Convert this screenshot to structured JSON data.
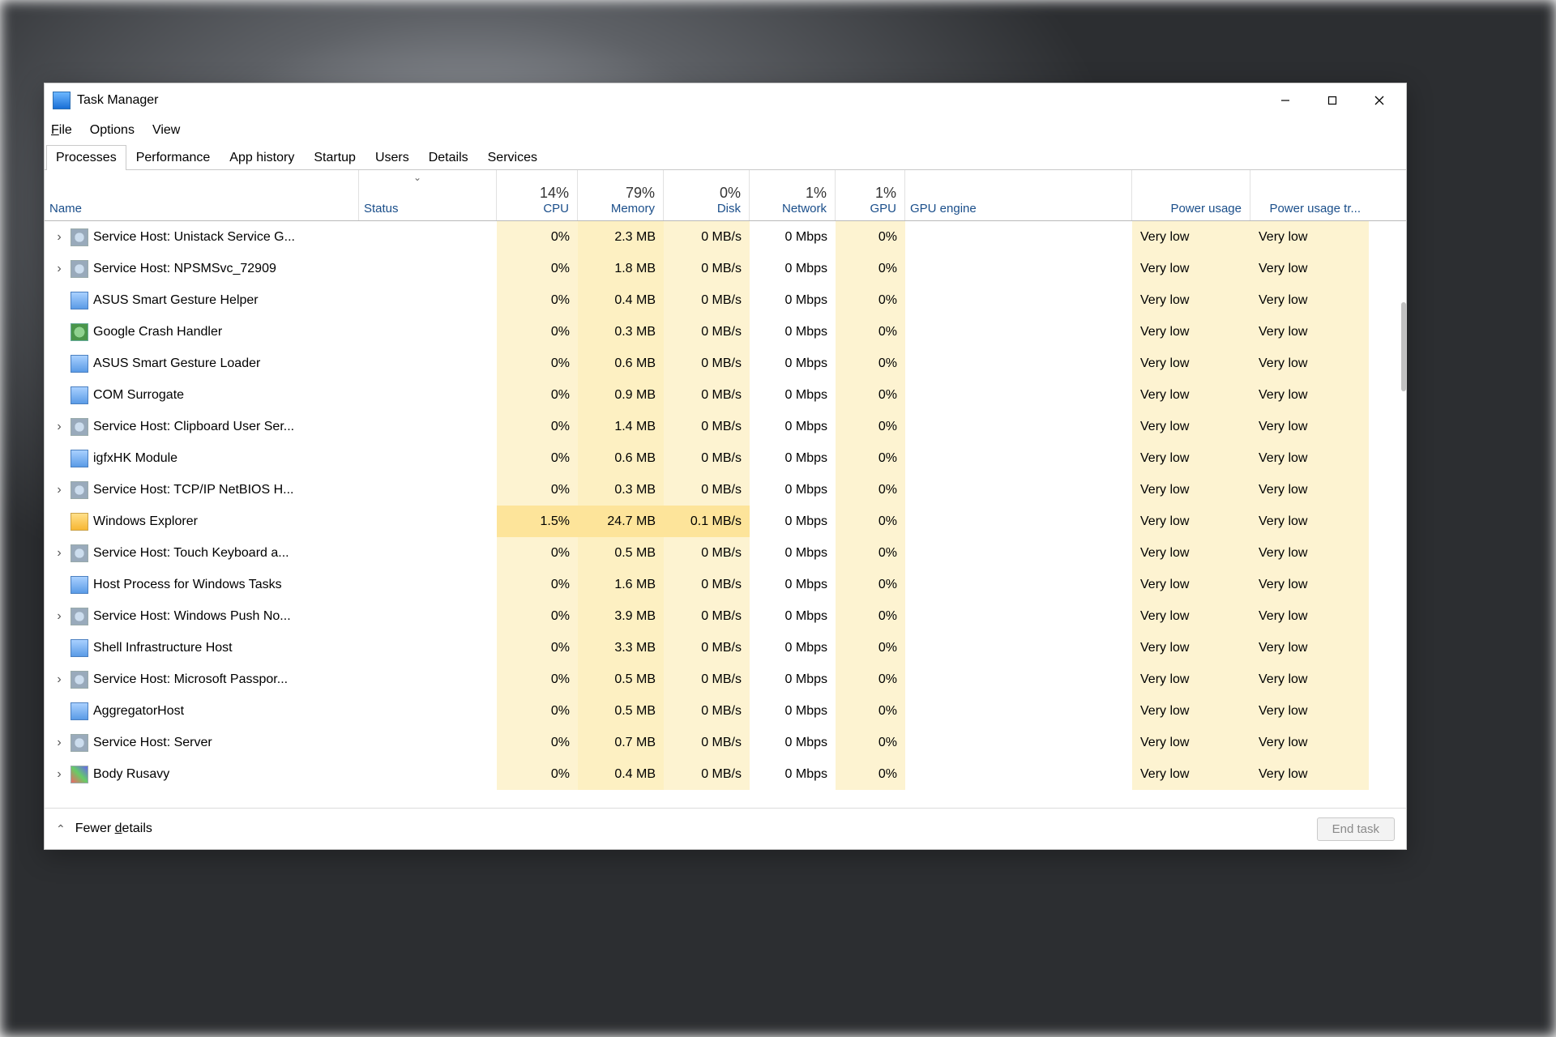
{
  "window": {
    "title": "Task Manager"
  },
  "menu": {
    "file": "File",
    "options": "Options",
    "view": "View"
  },
  "tabs": [
    "Processes",
    "Performance",
    "App history",
    "Startup",
    "Users",
    "Details",
    "Services"
  ],
  "active_tab": 0,
  "columns": {
    "name": "Name",
    "status": "Status",
    "cpu": "CPU",
    "memory": "Memory",
    "disk": "Disk",
    "network": "Network",
    "gpu": "GPU",
    "gpu_engine": "GPU engine",
    "power": "Power usage",
    "power_trend": "Power usage tr..."
  },
  "header_pct": {
    "cpu": "14%",
    "memory": "79%",
    "disk": "0%",
    "network": "1%",
    "gpu": "1%"
  },
  "rows": [
    {
      "exp": true,
      "icon": "gear",
      "name": "Service Host: Unistack Service G...",
      "cpu": "0%",
      "mem": "2.3 MB",
      "disk": "0 MB/s",
      "net": "0 Mbps",
      "gpu": "0%",
      "pw": "Very low",
      "pwt": "Very low"
    },
    {
      "exp": true,
      "icon": "gear",
      "name": "Service Host: NPSMSvc_72909",
      "cpu": "0%",
      "mem": "1.8 MB",
      "disk": "0 MB/s",
      "net": "0 Mbps",
      "gpu": "0%",
      "pw": "Very low",
      "pwt": "Very low"
    },
    {
      "exp": false,
      "icon": "blue",
      "name": "ASUS Smart Gesture Helper",
      "cpu": "0%",
      "mem": "0.4 MB",
      "disk": "0 MB/s",
      "net": "0 Mbps",
      "gpu": "0%",
      "pw": "Very low",
      "pwt": "Very low"
    },
    {
      "exp": false,
      "icon": "globe",
      "name": "Google Crash Handler",
      "cpu": "0%",
      "mem": "0.3 MB",
      "disk": "0 MB/s",
      "net": "0 Mbps",
      "gpu": "0%",
      "pw": "Very low",
      "pwt": "Very low"
    },
    {
      "exp": false,
      "icon": "blue",
      "name": "ASUS Smart Gesture Loader",
      "cpu": "0%",
      "mem": "0.6 MB",
      "disk": "0 MB/s",
      "net": "0 Mbps",
      "gpu": "0%",
      "pw": "Very low",
      "pwt": "Very low"
    },
    {
      "exp": false,
      "icon": "blue",
      "name": "COM Surrogate",
      "cpu": "0%",
      "mem": "0.9 MB",
      "disk": "0 MB/s",
      "net": "0 Mbps",
      "gpu": "0%",
      "pw": "Very low",
      "pwt": "Very low"
    },
    {
      "exp": true,
      "icon": "gear",
      "name": "Service Host: Clipboard User Ser...",
      "cpu": "0%",
      "mem": "1.4 MB",
      "disk": "0 MB/s",
      "net": "0 Mbps",
      "gpu": "0%",
      "pw": "Very low",
      "pwt": "Very low"
    },
    {
      "exp": false,
      "icon": "blue",
      "name": "igfxHK Module",
      "cpu": "0%",
      "mem": "0.6 MB",
      "disk": "0 MB/s",
      "net": "0 Mbps",
      "gpu": "0%",
      "pw": "Very low",
      "pwt": "Very low"
    },
    {
      "exp": true,
      "icon": "gear",
      "name": "Service Host: TCP/IP NetBIOS H...",
      "cpu": "0%",
      "mem": "0.3 MB",
      "disk": "0 MB/s",
      "net": "0 Mbps",
      "gpu": "0%",
      "pw": "Very low",
      "pwt": "Very low"
    },
    {
      "exp": false,
      "icon": "folder",
      "name": "Windows Explorer",
      "cpu": "1.5%",
      "mem": "24.7 MB",
      "disk": "0.1 MB/s",
      "net": "0 Mbps",
      "gpu": "0%",
      "pw": "Very low",
      "pwt": "Very low",
      "hot": true
    },
    {
      "exp": true,
      "icon": "gear",
      "name": "Service Host: Touch Keyboard a...",
      "cpu": "0%",
      "mem": "0.5 MB",
      "disk": "0 MB/s",
      "net": "0 Mbps",
      "gpu": "0%",
      "pw": "Very low",
      "pwt": "Very low"
    },
    {
      "exp": false,
      "icon": "blue",
      "name": "Host Process for Windows Tasks",
      "cpu": "0%",
      "mem": "1.6 MB",
      "disk": "0 MB/s",
      "net": "0 Mbps",
      "gpu": "0%",
      "pw": "Very low",
      "pwt": "Very low"
    },
    {
      "exp": true,
      "icon": "gear",
      "name": "Service Host: Windows Push No...",
      "cpu": "0%",
      "mem": "3.9 MB",
      "disk": "0 MB/s",
      "net": "0 Mbps",
      "gpu": "0%",
      "pw": "Very low",
      "pwt": "Very low"
    },
    {
      "exp": false,
      "icon": "blue",
      "name": "Shell Infrastructure Host",
      "cpu": "0%",
      "mem": "3.3 MB",
      "disk": "0 MB/s",
      "net": "0 Mbps",
      "gpu": "0%",
      "pw": "Very low",
      "pwt": "Very low"
    },
    {
      "exp": true,
      "icon": "gear",
      "name": "Service Host: Microsoft Passpor...",
      "cpu": "0%",
      "mem": "0.5 MB",
      "disk": "0 MB/s",
      "net": "0 Mbps",
      "gpu": "0%",
      "pw": "Very low",
      "pwt": "Very low"
    },
    {
      "exp": false,
      "icon": "blue",
      "name": "AggregatorHost",
      "cpu": "0%",
      "mem": "0.5 MB",
      "disk": "0 MB/s",
      "net": "0 Mbps",
      "gpu": "0%",
      "pw": "Very low",
      "pwt": "Very low"
    },
    {
      "exp": true,
      "icon": "gear",
      "name": "Service Host: Server",
      "cpu": "0%",
      "mem": "0.7 MB",
      "disk": "0 MB/s",
      "net": "0 Mbps",
      "gpu": "0%",
      "pw": "Very low",
      "pwt": "Very low"
    },
    {
      "exp": true,
      "icon": "color",
      "name": "Body Rusavy",
      "cpu": "0%",
      "mem": "0.4 MB",
      "disk": "0 MB/s",
      "net": "0 Mbps",
      "gpu": "0%",
      "pw": "Very low",
      "pwt": "Very low"
    }
  ],
  "footer": {
    "fewer": "Fewer details",
    "endtask": "End task"
  }
}
